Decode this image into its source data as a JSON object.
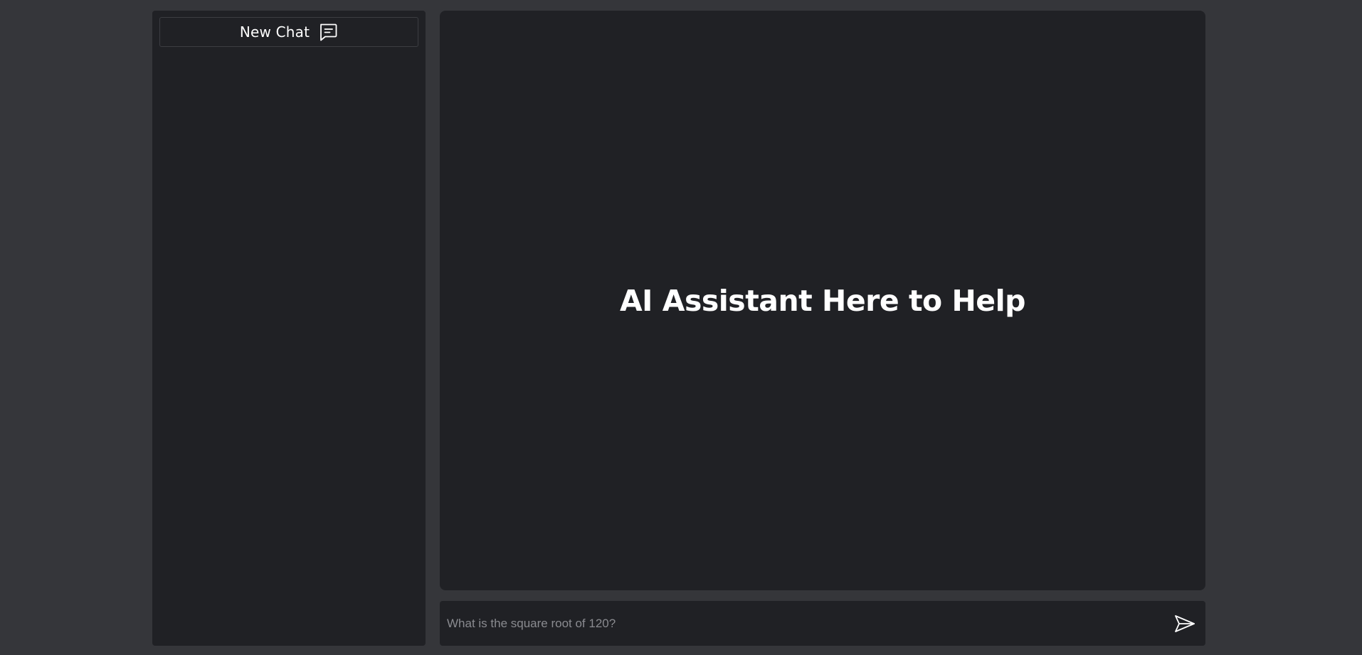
{
  "sidebar": {
    "new_chat_label": "New Chat",
    "new_chat_icon": "chat-bubble-icon"
  },
  "main": {
    "hero_title": "AI Assistant Here to Help"
  },
  "composer": {
    "placeholder": "What is the square root of 120?",
    "value": "",
    "send_icon": "send-icon"
  },
  "colors": {
    "page_background": "#35363a",
    "panel_background": "#202125",
    "text": "#ffffff",
    "placeholder": "#8a8b90",
    "border": "#3c3d42"
  }
}
